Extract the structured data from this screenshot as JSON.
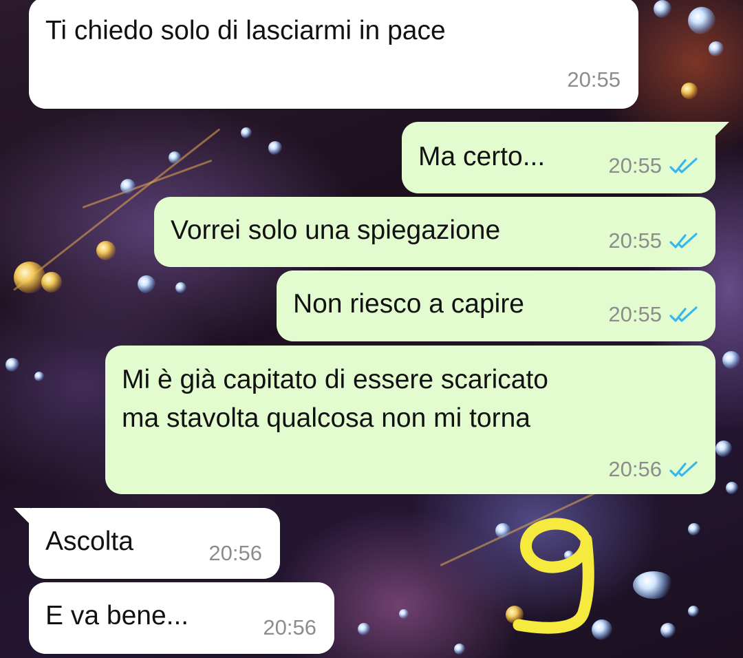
{
  "messages": [
    {
      "direction": "incoming",
      "text": "Ti chiedo solo di lasciarmi in pace",
      "time": "20:55"
    },
    {
      "direction": "outgoing",
      "text": "Ma certo...",
      "time": "20:55",
      "status": "read"
    },
    {
      "direction": "outgoing",
      "text": "Vorrei solo una spiegazione",
      "time": "20:55",
      "status": "read"
    },
    {
      "direction": "outgoing",
      "text": "Non riesco a capire",
      "time": "20:55",
      "status": "read"
    },
    {
      "direction": "outgoing",
      "text_lines": [
        "Mi è già capitato di essere scaricato",
        "ma stavolta qualcosa non mi torna"
      ],
      "time": "20:56",
      "status": "read"
    },
    {
      "direction": "incoming",
      "text": "Ascolta",
      "time": "20:56"
    },
    {
      "direction": "incoming",
      "text": "E va bene...",
      "time": "20:56"
    }
  ],
  "overlay": {
    "drawing": "handwritten-number-9",
    "color": "#f7ea3f"
  },
  "icons": {
    "read_receipt": "double-check-icon"
  },
  "colors": {
    "incoming_bubble": "#ffffff",
    "outgoing_bubble": "#e2fbcf",
    "read_tick": "#34b7f1",
    "timestamp": "#8c8c8c"
  }
}
